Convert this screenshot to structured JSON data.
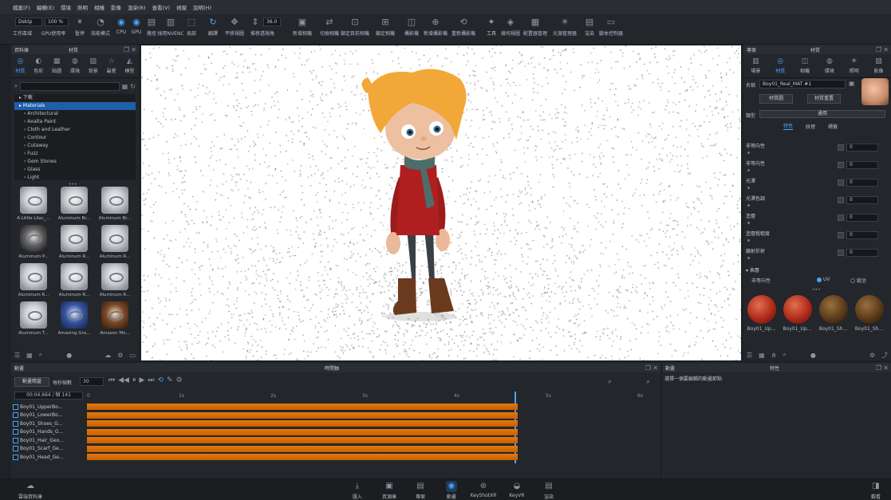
{
  "menu": [
    "檔案(F)",
    "編輯(E)",
    "環境",
    "照明",
    "相機",
    "影像",
    "渲染(R)",
    "查看(V)",
    "視窗",
    "說明(H)"
  ],
  "toolbar": {
    "preset_value": "Dsktp",
    "percent_value": "100 %",
    "fov_value": "36.0",
    "buttons": [
      {
        "label": "工作區域",
        "icon": "workspace-icon"
      },
      {
        "label": "GPU使用率",
        "icon": "gpu-icon"
      },
      {
        "label": "暫停",
        "icon": "pause-icon"
      },
      {
        "label": "效能模式",
        "icon": "performance-icon"
      },
      {
        "label": "CPU",
        "icon": "cpu-icon"
      },
      {
        "label": "GPU",
        "icon": "gpu-mode-icon"
      },
      {
        "label": "路徑",
        "icon": "path-icon"
      },
      {
        "label": "採用NVENC",
        "icon": "nvenc-icon"
      },
      {
        "label": "局部",
        "icon": "region-icon"
      },
      {
        "label": "翻譯",
        "icon": "rotate-icon"
      },
      {
        "label": "平移視圖",
        "icon": "pan-icon"
      },
      {
        "label": "推移",
        "icon": "dolly-icon"
      },
      {
        "label": "透視角",
        "icon": "perspective-icon"
      },
      {
        "label": "新增相機",
        "icon": "add-camera-icon"
      },
      {
        "label": "切換相機",
        "icon": "switch-camera-icon"
      },
      {
        "label": "鎖定目前相機",
        "icon": "lock-camera-icon"
      },
      {
        "label": "鎖定相機",
        "icon": "lock-icon"
      },
      {
        "label": "攝影機",
        "icon": "camera-icon"
      },
      {
        "label": "新增攝影機",
        "icon": "add-video-icon"
      },
      {
        "label": "重新攝影機",
        "icon": "reset-camera-icon"
      },
      {
        "label": "工具",
        "icon": "tools-icon"
      },
      {
        "label": "幾何視圖",
        "icon": "geometry-icon"
      },
      {
        "label": "配置器管理",
        "icon": "configurator-icon"
      },
      {
        "label": "光源管理器",
        "icon": "light-manager-icon"
      },
      {
        "label": "渲染",
        "icon": "render-icon"
      },
      {
        "label": "腳本控制器",
        "icon": "script-icon"
      }
    ]
  },
  "library": {
    "header_left": "資料庫",
    "header_center": "材質",
    "tabs": [
      {
        "label": "材質",
        "icon": "material-icon"
      },
      {
        "label": "色彩",
        "icon": "color-icon"
      },
      {
        "label": "貼圖",
        "icon": "texture-icon"
      },
      {
        "label": "環境",
        "icon": "environment-icon"
      },
      {
        "label": "背景",
        "icon": "background-icon"
      },
      {
        "label": "最愛",
        "icon": "favorite-icon"
      },
      {
        "label": "模型",
        "icon": "model-icon"
      }
    ],
    "tree": [
      {
        "label": "下載",
        "sel": false,
        "child": false
      },
      {
        "label": "Materials",
        "sel": true,
        "child": false
      },
      {
        "label": "Architectural",
        "sel": false,
        "child": true
      },
      {
        "label": "Axalta Paint",
        "sel": false,
        "child": true
      },
      {
        "label": "Cloth and Leather",
        "sel": false,
        "child": true
      },
      {
        "label": "Contour",
        "sel": false,
        "child": true
      },
      {
        "label": "Cutaway",
        "sel": false,
        "child": true
      },
      {
        "label": "Fuzz",
        "sel": false,
        "child": true
      },
      {
        "label": "Gem Stones",
        "sel": false,
        "child": true
      },
      {
        "label": "Glass",
        "sel": false,
        "child": true
      },
      {
        "label": "Light",
        "sel": false,
        "child": true
      }
    ],
    "thumbs": [
      "A Little Lilac_...",
      "Aluminum Br...",
      "Aluminum Br...",
      "Aluminum P...",
      "Aluminum R...",
      "Aluminum R...",
      "Aluminum R...",
      "Aluminum R...",
      "Aluminum R...",
      "Aluminum T...",
      "Amazing Gra...",
      "Amazon Mo..."
    ]
  },
  "right_panel": {
    "header_left": "專案",
    "header_center": "材質",
    "tabs": [
      {
        "label": "場景",
        "icon": "scene-icon"
      },
      {
        "label": "材質",
        "icon": "material-icon"
      },
      {
        "label": "相機",
        "icon": "camera-icon"
      },
      {
        "label": "環境",
        "icon": "environment-icon"
      },
      {
        "label": "照明",
        "icon": "lighting-icon"
      },
      {
        "label": "影像",
        "icon": "image-icon"
      }
    ],
    "name_label": "名稱",
    "name_value": "Boy01_Real_MAT #1",
    "btn_material_graph": "材質圖",
    "btn_material_reset": "材質重置",
    "type_label": "類型",
    "type_value": "通用",
    "subtabs": [
      "特性",
      "紋理",
      "標籤"
    ],
    "props": [
      {
        "label": "非等向性",
        "value": "0"
      },
      {
        "label": "非等向性",
        "value": "0"
      },
      {
        "label": "光澤",
        "value": "0"
      },
      {
        "label": "光澤色調",
        "value": "0"
      },
      {
        "label": "塗層",
        "value": "0"
      },
      {
        "label": "塗層粗糙度",
        "value": "0"
      },
      {
        "label": "鏡射折射",
        "value": "0"
      }
    ],
    "section_title": "表層",
    "aniso_label": "非等向性",
    "option_a": "UV",
    "option_b": "縱坐",
    "balls": [
      "Boy01_Up...",
      "Boy01_Up...",
      "Boy01_Sh...",
      "Boy01_Sh..."
    ]
  },
  "timeline": {
    "left_title": "動畫",
    "center_title": "時間軸",
    "btn_add_animation": "動畫精靈",
    "fps_label": "每秒幀數",
    "fps_value": "30",
    "time_value": "00:04.664 / 幀 141",
    "ruler": [
      "0",
      "1s",
      "2s",
      "3s",
      "4s",
      "5s",
      "6s"
    ],
    "tracks": [
      "Boy01_UpperBo...",
      "Boy01_LowerBo...",
      "Boy01_Shoes_G...",
      "Boy01_Hands_G...",
      "Boy01_Hair_Geo...",
      "Boy01_Scarf_Ge...",
      "Boy01_Head_Ge..."
    ],
    "progress": 0.78
  },
  "properties": {
    "left_title": "動畫",
    "center_title": "特性",
    "hint": "選擇一個要編輯的動畫節點"
  },
  "dock": [
    {
      "label": "匯入",
      "icon": "import-icon"
    },
    {
      "label": "資源庫",
      "icon": "library-icon"
    },
    {
      "label": "專案",
      "icon": "project-icon"
    },
    {
      "label": "動畫",
      "icon": "animation-icon",
      "active": true
    },
    {
      "label": "KeyShotXR",
      "icon": "keyshotxr-icon"
    },
    {
      "label": "KeyVR",
      "icon": "keyvr-icon"
    },
    {
      "label": "渲染",
      "icon": "render-icon"
    }
  ],
  "dock_left": "雲端資料庫",
  "dock_right": "觀看"
}
